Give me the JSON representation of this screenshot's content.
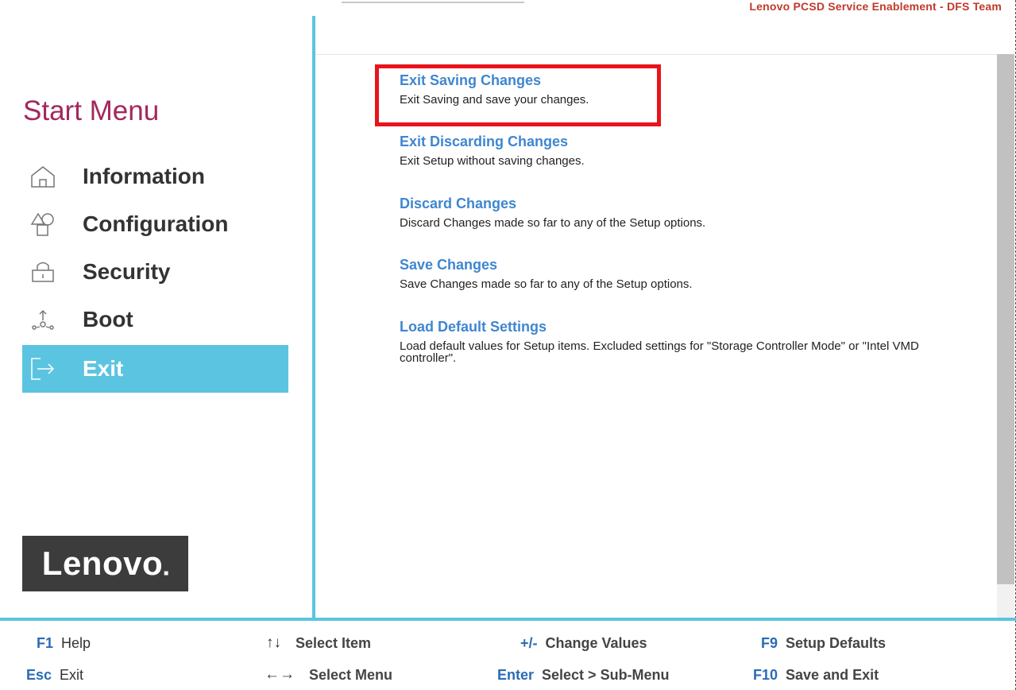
{
  "header": {
    "credit": "Lenovo PCSD Service Enablement - DFS Team"
  },
  "sidebar": {
    "title": "Start Menu",
    "items": [
      {
        "label": "Information",
        "icon": "home-icon"
      },
      {
        "label": "Configuration",
        "icon": "shapes-icon"
      },
      {
        "label": "Security",
        "icon": "lock-icon"
      },
      {
        "label": "Boot",
        "icon": "boot-icon"
      },
      {
        "label": "Exit",
        "icon": "exit-icon",
        "active": true
      }
    ],
    "logo": "Lenovo"
  },
  "main": {
    "options": [
      {
        "title": "Exit Saving Changes",
        "desc": "Exit Saving and save your changes."
      },
      {
        "title": "Exit Discarding Changes",
        "desc": "Exit Setup without saving changes."
      },
      {
        "title": "Discard Changes",
        "desc": "Discard Changes made so far to any of the Setup options."
      },
      {
        "title": "Save Changes",
        "desc": "Save Changes made so far to any of the Setup options."
      },
      {
        "title": "Load Default Settings",
        "desc": "Load default values for Setup items. Excluded settings for \"Storage Controller Mode\" or \"Intel VMD controller\"."
      }
    ]
  },
  "footer": {
    "hotkeys": [
      {
        "key": "F1",
        "desc": "Help"
      },
      {
        "key": "Esc",
        "desc": "Exit"
      },
      {
        "key": "↑↓",
        "desc": "Select Item"
      },
      {
        "key": "←→",
        "desc": "Select Menu"
      },
      {
        "key": "+/-",
        "desc": "Change Values"
      },
      {
        "key": "Enter",
        "desc": "Select > Sub-Menu"
      },
      {
        "key": "F9",
        "desc": "Setup Defaults"
      },
      {
        "key": "F10",
        "desc": "Save and Exit"
      }
    ]
  },
  "colors": {
    "accent": "#5bc4e0",
    "title": "#a3275f",
    "link": "#3f86d0",
    "highlight": "#e8141c",
    "credit": "#c0392b"
  }
}
